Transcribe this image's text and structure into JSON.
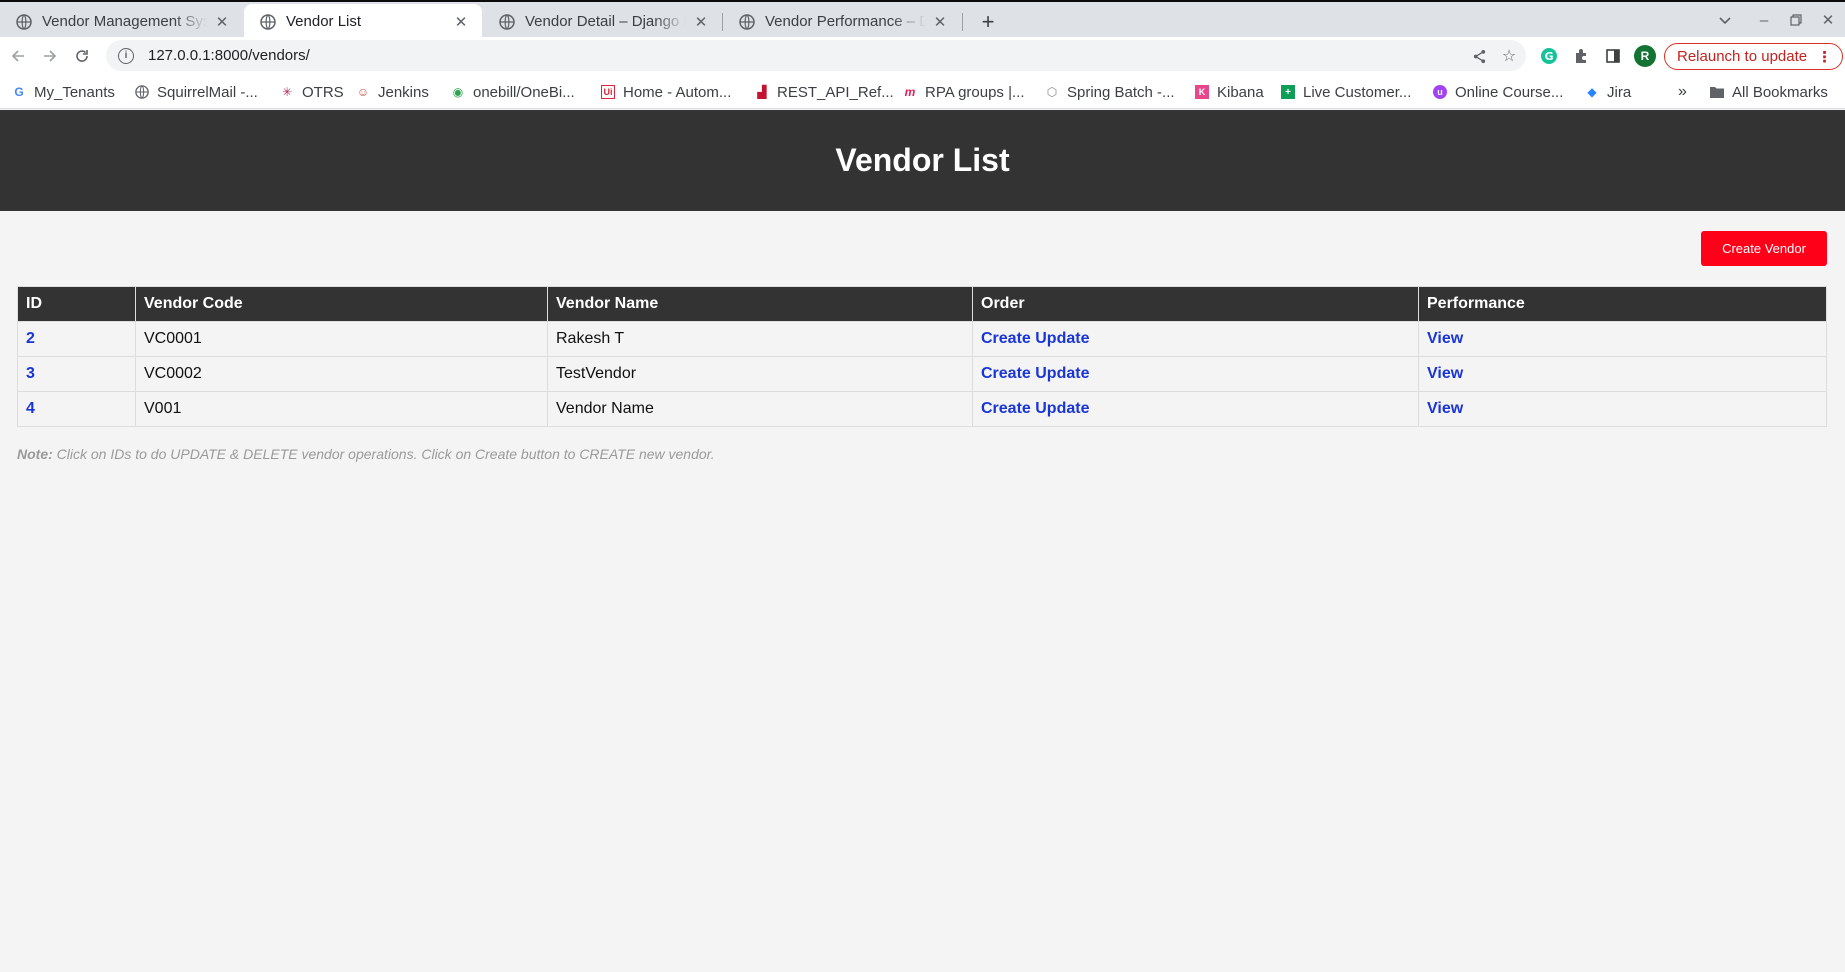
{
  "browser": {
    "tabs": [
      {
        "title": "Vendor Management Sys",
        "active": false
      },
      {
        "title": "Vendor List",
        "active": true
      },
      {
        "title": "Vendor Detail – Django R",
        "active": false
      },
      {
        "title": "Vendor Performance – Dj",
        "active": false
      }
    ],
    "url": "127.0.0.1:8000/vendors/",
    "avatar_letter": "R",
    "relaunch_label": "Relaunch to update",
    "bookmarks": [
      {
        "label": "My_Tenants",
        "icon": "google-icon",
        "color": "#4285f4"
      },
      {
        "label": "SquirrelMail -...",
        "icon": "globe-icon",
        "color": "#5f6368"
      },
      {
        "label": "OTRS",
        "icon": "otrs-icon",
        "color": "#b32b5b"
      },
      {
        "label": "Jenkins",
        "icon": "jenkins-icon",
        "color": "#d24939"
      },
      {
        "label": "onebill/OneBi...",
        "icon": "onebill-icon",
        "color": "#2ea44f"
      },
      {
        "label": "Home - Autom...",
        "icon": "uipath-icon",
        "color": "#d9263a"
      },
      {
        "label": "REST_API_Ref...",
        "icon": "rest-api-icon",
        "color": "#c4122f"
      },
      {
        "label": "RPA groups |...",
        "icon": "rpa-icon",
        "color": "#e01e5a"
      },
      {
        "label": "Spring Batch -...",
        "icon": "spring-icon",
        "color": "#888888"
      },
      {
        "label": "Kibana",
        "icon": "kibana-icon",
        "color": "#e8478b"
      },
      {
        "label": "Live Customer...",
        "icon": "sheets-icon",
        "color": "#0f9d58"
      },
      {
        "label": "Online Course...",
        "icon": "course-icon",
        "color": "#a142f4"
      },
      {
        "label": "Jira",
        "icon": "jira-icon",
        "color": "#2684ff"
      }
    ],
    "all_bookmarks_label": "All Bookmarks"
  },
  "page": {
    "title": "Vendor List",
    "create_button": "Create Vendor",
    "table": {
      "headers": [
        "ID",
        "Vendor Code",
        "Vendor Name",
        "Order",
        "Performance"
      ],
      "rows": [
        {
          "id": "2",
          "code": "VC0001",
          "name": "Rakesh T",
          "order": "Create Update",
          "performance": "View"
        },
        {
          "id": "3",
          "code": "VC0002",
          "name": "TestVendor",
          "order": "Create Update",
          "performance": "View"
        },
        {
          "id": "4",
          "code": "V001",
          "name": "Vendor Name",
          "order": "Create Update",
          "performance": "View"
        }
      ]
    },
    "note_label": "Note:",
    "note_text": "Click on IDs to do UPDATE & DELETE vendor operations. Click on Create button to CREATE new vendor."
  },
  "colors": {
    "header_bg": "#333333",
    "create_button_bg": "#ff0019",
    "link": "#1a35d6",
    "page_bg": "#f4f4f4"
  }
}
